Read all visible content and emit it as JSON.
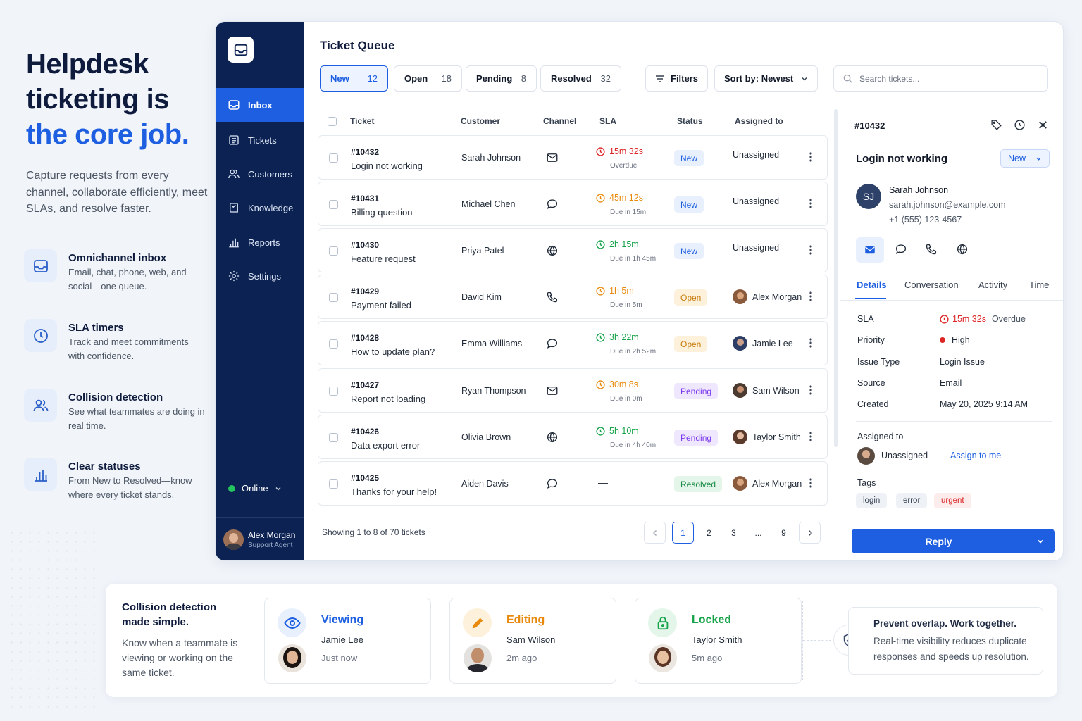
{
  "hero": {
    "title_line1": "Helpdesk",
    "title_line2": "ticketing is",
    "title_line3": "the core job.",
    "description": "Capture requests from every channel, collaborate efficiently, meet SLAs, and resolve faster."
  },
  "features": [
    {
      "title": "Omnichannel inbox",
      "desc": "Email, chat, phone, web, and social—one queue.",
      "icon": "inbox-icon"
    },
    {
      "title": "SLA timers",
      "desc": "Track and meet commitments with confidence.",
      "icon": "clock-icon"
    },
    {
      "title": "Collision detection",
      "desc": "See what teammates are doing in real time.",
      "icon": "users-icon"
    },
    {
      "title": "Clear statuses",
      "desc": "From New to Resolved—know where every ticket stands.",
      "icon": "bar-chart-icon"
    }
  ],
  "sidebar": {
    "items": [
      {
        "label": "Inbox",
        "icon": "inbox-icon",
        "active": true
      },
      {
        "label": "Tickets",
        "icon": "ticket-icon"
      },
      {
        "label": "Customers",
        "icon": "users-icon"
      },
      {
        "label": "Knowledge",
        "icon": "book-icon"
      },
      {
        "label": "Reports",
        "icon": "bar-chart-icon"
      },
      {
        "label": "Settings",
        "icon": "gear-icon"
      }
    ],
    "status": "Online",
    "user": {
      "name": "Alex Morgan",
      "role": "Support Agent"
    }
  },
  "queue": {
    "title": "Ticket Queue",
    "tabs": [
      {
        "label": "New",
        "count": "12",
        "active": true
      },
      {
        "label": "Open",
        "count": "18"
      },
      {
        "label": "Pending",
        "count": "8"
      },
      {
        "label": "Resolved",
        "count": "32"
      }
    ],
    "filters_label": "Filters",
    "sort_label": "Sort by: Newest",
    "search_placeholder": "Search tickets...",
    "columns": [
      "Ticket",
      "Customer",
      "Channel",
      "SLA",
      "Status",
      "Assigned to"
    ],
    "rows": [
      {
        "id": "#10432",
        "subject": "Login not working",
        "customer": "Sarah Johnson",
        "channel": "mail-icon",
        "sla": "15m 32s",
        "sla_note": "Overdue",
        "sla_color": "#dc2626",
        "status": "New",
        "assigned": "Unassigned"
      },
      {
        "id": "#10431",
        "subject": "Billing question",
        "customer": "Michael Chen",
        "channel": "chat-icon",
        "sla": "45m 12s",
        "sla_note": "Due in 15m",
        "sla_color": "#e8890b",
        "status": "New",
        "assigned": "Unassigned"
      },
      {
        "id": "#10430",
        "subject": "Feature request",
        "customer": "Priya Patel",
        "channel": "globe-icon",
        "sla": "2h 15m",
        "sla_note": "Due in 1h 45m",
        "sla_color": "#16a34a",
        "status": "New",
        "assigned": "Unassigned"
      },
      {
        "id": "#10429",
        "subject": "Payment failed",
        "customer": "David Kim",
        "channel": "phone-icon",
        "sla": "1h 5m",
        "sla_note": "Due in 5m",
        "sla_color": "#e8890b",
        "status": "Open",
        "assigned": "Alex Morgan"
      },
      {
        "id": "#10428",
        "subject": "How to update plan?",
        "customer": "Emma Williams",
        "channel": "chat-icon",
        "sla": "3h 22m",
        "sla_note": "Due in 2h 52m",
        "sla_color": "#16a34a",
        "status": "Open",
        "assigned": "Jamie Lee"
      },
      {
        "id": "#10427",
        "subject": "Report not loading",
        "customer": "Ryan Thompson",
        "channel": "mail-icon",
        "sla": "30m 8s",
        "sla_note": "Due in 0m",
        "sla_color": "#e8890b",
        "status": "Pending",
        "assigned": "Sam Wilson"
      },
      {
        "id": "#10426",
        "subject": "Data export error",
        "customer": "Olivia Brown",
        "channel": "globe-icon",
        "sla": "5h 10m",
        "sla_note": "Due in 4h 40m",
        "sla_color": "#16a34a",
        "status": "Pending",
        "assigned": "Taylor Smith"
      },
      {
        "id": "#10425",
        "subject": "Thanks for your help!",
        "customer": "Aiden Davis",
        "channel": "chat-icon",
        "sla": "—",
        "sla_note": "",
        "sla_color": "#1f2937",
        "status": "Resolved",
        "assigned": "Alex Morgan"
      }
    ],
    "showing": "Showing 1 to 8 of 70 tickets",
    "pages": [
      "1",
      "2",
      "3",
      "...",
      "9"
    ],
    "current_page": "1"
  },
  "detail": {
    "id": "#10432",
    "title": "Login not working",
    "status": "New",
    "customer": {
      "initials": "SJ",
      "name": "Sarah Johnson",
      "email": "sarah.johnson@example.com",
      "phone": "+1 (555) 123-4567"
    },
    "tabs": [
      "Details",
      "Conversation",
      "Activity",
      "Time"
    ],
    "fields": [
      {
        "key": "SLA",
        "value": "15m 32s",
        "extra": "Overdue"
      },
      {
        "key": "Priority",
        "value": "High"
      },
      {
        "key": "Issue Type",
        "value": "Login Issue"
      },
      {
        "key": "Source",
        "value": "Email"
      },
      {
        "key": "Created",
        "value": "May 20, 2025 9:14 AM"
      }
    ],
    "assigned_label": "Assigned to",
    "assigned_value": "Unassigned",
    "assign_link": "Assign to me",
    "tags_label": "Tags",
    "tags": [
      {
        "label": "login"
      },
      {
        "label": "error"
      },
      {
        "label": "urgent",
        "color": "#dc2626"
      }
    ],
    "reply_label": "Reply"
  },
  "collision": {
    "title": "Collision detection made simple.",
    "desc": "Know when a teammate is viewing or working on the same ticket.",
    "cards": [
      {
        "label": "Viewing",
        "name": "Jamie Lee",
        "time": "Just now",
        "color": "#1d5fe0",
        "icon": "eye-icon"
      },
      {
        "label": "Editing",
        "name": "Sam Wilson",
        "time": "2m ago",
        "color": "#e8890b",
        "icon": "pencil-icon"
      },
      {
        "label": "Locked",
        "name": "Taylor Smith",
        "time": "5m ago",
        "color": "#16a34a",
        "icon": "lock-icon"
      }
    ],
    "callout_title": "Prevent overlap. Work together.",
    "callout_desc": "Real-time visibility reduces duplicate responses and speeds up resolution."
  },
  "colors": {
    "brand": "#1d5fe0",
    "sidebar": "#0c2252",
    "danger": "#dc2626",
    "warning": "#e8890b",
    "success": "#16a34a"
  }
}
